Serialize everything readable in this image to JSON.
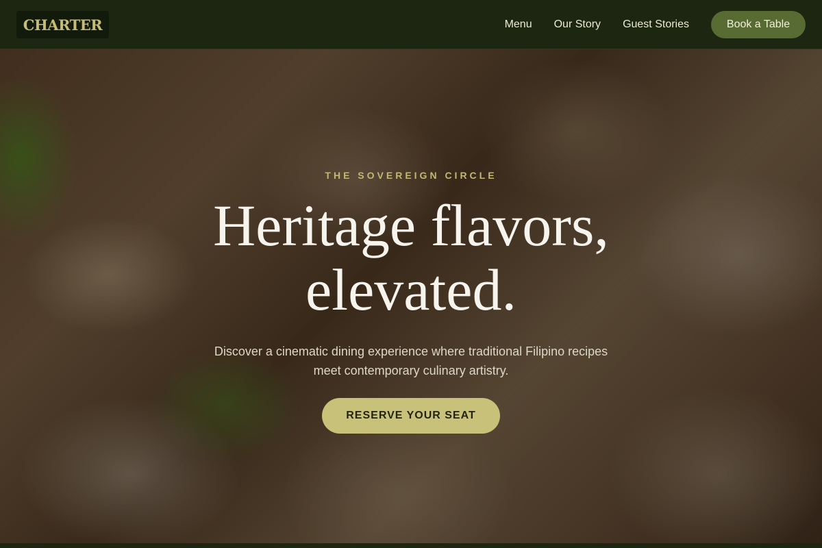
{
  "brand": {
    "logo_text": "CHARTER"
  },
  "nav": {
    "links": [
      "Menu",
      "Our Story",
      "Guest Stories"
    ],
    "cta_label": "Book a Table"
  },
  "hero": {
    "eyebrow": "THE SOVEREIGN CIRCLE",
    "headline_line1": "Heritage flavors,",
    "headline_line2": "elevated.",
    "subtext": "Discover a cinematic dining experience where traditional Filipino recipes meet contemporary culinary artistry.",
    "cta_label": "RESERVE YOUR SEAT",
    "background_image": "crispy-pork-lechon-photo"
  },
  "colors": {
    "nav_bg": "#1c2611",
    "accent_gold": "#c8c17a",
    "accent_green": "#586b33",
    "text_light": "#f6f4ec"
  }
}
